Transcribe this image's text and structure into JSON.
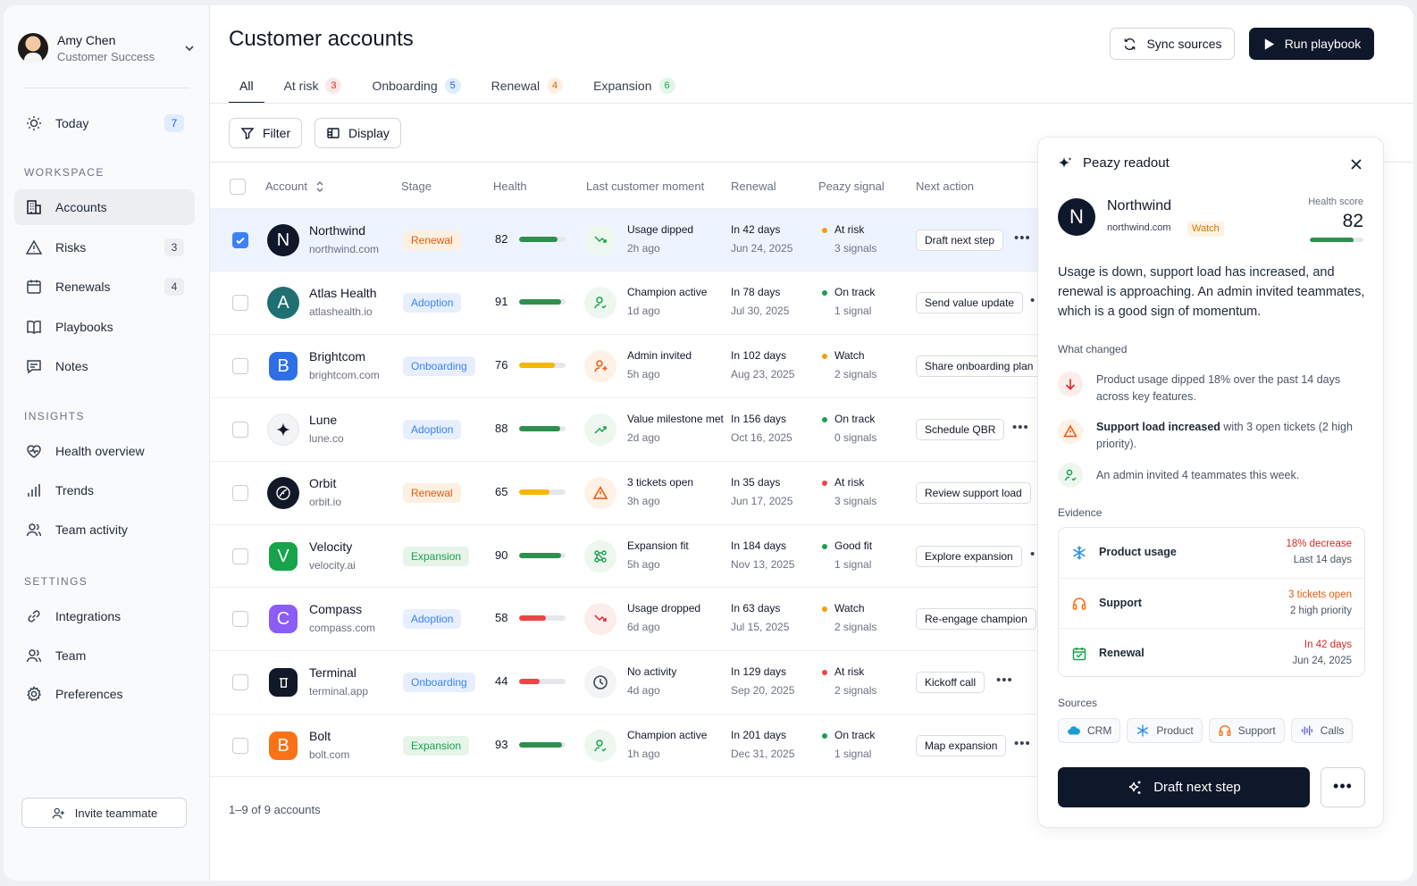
{
  "user": {
    "name": "Amy Chen",
    "role": "Customer Success"
  },
  "sidebar": {
    "top_items": [
      {
        "label": "Today",
        "count": "7"
      }
    ],
    "workspace_label": "WORKSPACE",
    "workspace": [
      {
        "label": "Accounts",
        "count": ""
      },
      {
        "label": "Risks",
        "count": "3"
      },
      {
        "label": "Renewals",
        "count": "4"
      },
      {
        "label": "Playbooks",
        "count": ""
      },
      {
        "label": "Notes",
        "count": ""
      }
    ],
    "insights_label": "INSIGHTS",
    "insights": [
      {
        "label": "Health overview"
      },
      {
        "label": "Trends"
      },
      {
        "label": "Team activity"
      }
    ],
    "settings_label": "SETTINGS",
    "settings": [
      {
        "label": "Integrations"
      },
      {
        "label": "Team"
      },
      {
        "label": "Preferences"
      }
    ],
    "invite_label": "Invite teammate"
  },
  "header": {
    "title": "Customer accounts",
    "sync_label": "Sync sources",
    "run_label": "Run playbook"
  },
  "tabs": [
    {
      "label": "All",
      "count": ""
    },
    {
      "label": "At risk",
      "count": "3"
    },
    {
      "label": "Onboarding",
      "count": "5"
    },
    {
      "label": "Renewal",
      "count": "4"
    },
    {
      "label": "Expansion",
      "count": "6"
    }
  ],
  "toolbar": {
    "filter_label": "Filter",
    "display_label": "Display"
  },
  "table": {
    "columns": [
      "Account",
      "Stage",
      "Health",
      "Last customer moment",
      "Renewal",
      "Peazy signal",
      "Next action"
    ],
    "rows": [
      {
        "name": "Northwind",
        "domain": "northwind.com",
        "initial": "N",
        "stage": "Renewal",
        "health": 82,
        "moment": "Usage dipped",
        "moment_time": "2h ago",
        "renewal_in": "In 42 days",
        "renewal_date": "Jun 24, 2025",
        "signal": "At risk",
        "signal_count": "3 signals",
        "next": "Draft next step"
      },
      {
        "name": "Atlas Health",
        "domain": "atlashealth.io",
        "initial": "A",
        "stage": "Adoption",
        "health": 91,
        "moment": "Champion active",
        "moment_time": "1d ago",
        "renewal_in": "In 78 days",
        "renewal_date": "Jul 30, 2025",
        "signal": "On track",
        "signal_count": "1 signal",
        "next": "Send value update"
      },
      {
        "name": "Brightcom",
        "domain": "brightcom.com",
        "initial": "B",
        "stage": "Onboarding",
        "health": 76,
        "moment": "Admin invited",
        "moment_time": "5h ago",
        "renewal_in": "In 102 days",
        "renewal_date": "Aug 23, 2025",
        "signal": "Watch",
        "signal_count": "2 signals",
        "next": "Share onboarding plan"
      },
      {
        "name": "Lune",
        "domain": "lune.co",
        "initial": "",
        "stage": "Adoption",
        "health": 88,
        "moment": "Value milestone met",
        "moment_time": "2d ago",
        "renewal_in": "In 156 days",
        "renewal_date": "Oct 16, 2025",
        "signal": "On track",
        "signal_count": "0 signals",
        "next": "Schedule QBR"
      },
      {
        "name": "Orbit",
        "domain": "orbit.io",
        "initial": "",
        "stage": "Renewal",
        "health": 65,
        "moment": "3 tickets open",
        "moment_time": "3h ago",
        "renewal_in": "In 35 days",
        "renewal_date": "Jun 17, 2025",
        "signal": "At risk",
        "signal_count": "3 signals",
        "next": "Review support load"
      },
      {
        "name": "Velocity",
        "domain": "velocity.ai",
        "initial": "V",
        "stage": "Expansion",
        "health": 90,
        "moment": "Expansion fit",
        "moment_time": "5h ago",
        "renewal_in": "In 184 days",
        "renewal_date": "Nov 13, 2025",
        "signal": "Good fit",
        "signal_count": "1 signal",
        "next": "Explore expansion"
      },
      {
        "name": "Compass",
        "domain": "compass.com",
        "initial": "C",
        "stage": "Adoption",
        "health": 58,
        "moment": "Usage dropped",
        "moment_time": "6d ago",
        "renewal_in": "In 63 days",
        "renewal_date": "Jul 15, 2025",
        "signal": "Watch",
        "signal_count": "2 signals",
        "next": "Re-engage champion"
      },
      {
        "name": "Terminal",
        "domain": "terminal.app",
        "initial": "",
        "stage": "Onboarding",
        "health": 44,
        "moment": "No activity",
        "moment_time": "4d ago",
        "renewal_in": "In 129 days",
        "renewal_date": "Sep 20, 2025",
        "signal": "At risk",
        "signal_count": "2 signals",
        "next": "Kickoff call"
      },
      {
        "name": "Bolt",
        "domain": "bolt.com",
        "initial": "B",
        "stage": "Expansion",
        "health": 93,
        "moment": "Champion active",
        "moment_time": "1h ago",
        "renewal_in": "In 201 days",
        "renewal_date": "Dec 31, 2025",
        "signal": "On track",
        "signal_count": "1 signal",
        "next": "Map expansion"
      }
    ],
    "footer": "1–9 of 9 accounts"
  },
  "colors": {
    "at_risk": "#ef4444",
    "watch": "#f59e0b",
    "on_track": "#16a34a",
    "health_good": "#2f8f4e",
    "health_mid": "#f5b800",
    "health_low": "#ef4444"
  },
  "panel": {
    "title": "Peazy readout",
    "account": {
      "initial": "N",
      "name": "Northwind",
      "domain": "northwind.com",
      "badge": "Watch",
      "health_label": "Health score",
      "health": "82"
    },
    "summary": "Usage is down, support load has increased, and renewal is approaching. An admin invited teammates, which is a good sign of momentum.",
    "what_changed_label": "What changed",
    "changes": [
      {
        "bold": "",
        "text": "Product usage dipped 18% over the past 14 days across key features."
      },
      {
        "bold": "Support load increased",
        "text": " with 3 open tickets (2 high priority)."
      },
      {
        "bold": "",
        "text": "An admin invited 4 teammates this week."
      }
    ],
    "evidence_label": "Evidence",
    "evidence": [
      {
        "label": "Product usage",
        "value": "18% decrease",
        "detail": "Last 14 days"
      },
      {
        "label": "Support",
        "value": "3 tickets open",
        "detail": "2 high priority"
      },
      {
        "label": "Renewal",
        "value": "In 42 days",
        "detail": "Jun 24, 2025"
      }
    ],
    "sources_label": "Sources",
    "sources": [
      "CRM",
      "Product",
      "Support",
      "Calls"
    ],
    "draft_label": "Draft next step",
    "more_label": "•••"
  }
}
